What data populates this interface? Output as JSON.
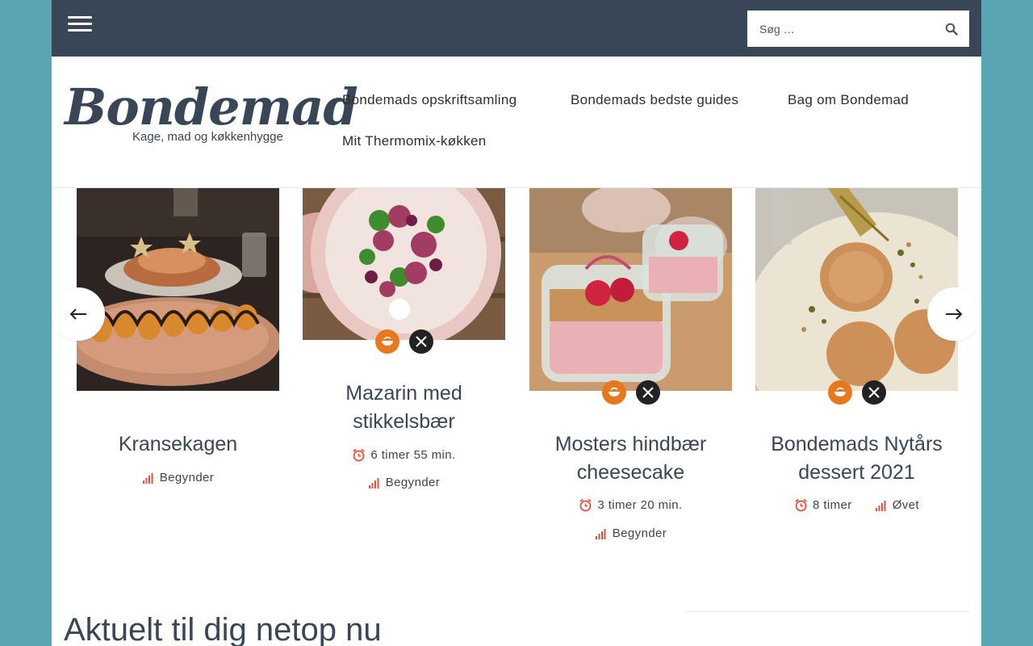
{
  "topbar": {
    "search_placeholder": "Søg …"
  },
  "header": {
    "logo_text": "Bondemad",
    "logo_tagline": "Kage, mad og køkkenhygge",
    "nav": [
      {
        "label": "Bondemads opskriftsamling"
      },
      {
        "label": "Bondemads bedste guides"
      },
      {
        "label": "Bag om Bondemad"
      },
      {
        "label": "Mit Thermomix-køkken"
      }
    ]
  },
  "recipes": [
    {
      "title": "Kransekagen",
      "time": "",
      "level": "Begynder"
    },
    {
      "title": "Mazarin med stikkelsbær",
      "time": "6 timer 55 min.",
      "level": "Begynder"
    },
    {
      "title": "Mosters hindbær cheesecake",
      "time": "3 timer 20 min.",
      "level": "Begynder"
    },
    {
      "title": "Bondemads Nytårs dessert 2021",
      "time": "8 timer",
      "level": "Øvet"
    }
  ],
  "icons": {
    "menu": "hamburger-icon",
    "search": "search-icon",
    "prev": "arrow-left-icon",
    "next": "arrow-right-icon",
    "time": "alarm-clock-icon",
    "level": "signal-bars-icon",
    "category": "bowl-icon",
    "meal": "fork-knife-icon"
  },
  "colors": {
    "background": "#5aa5b4",
    "topbar": "#384658",
    "text_dark": "#384658",
    "accent_orange": "#e8781e",
    "accent_red": "#e9503b"
  },
  "section": {
    "title": "Aktuelt til dig netop nu"
  }
}
